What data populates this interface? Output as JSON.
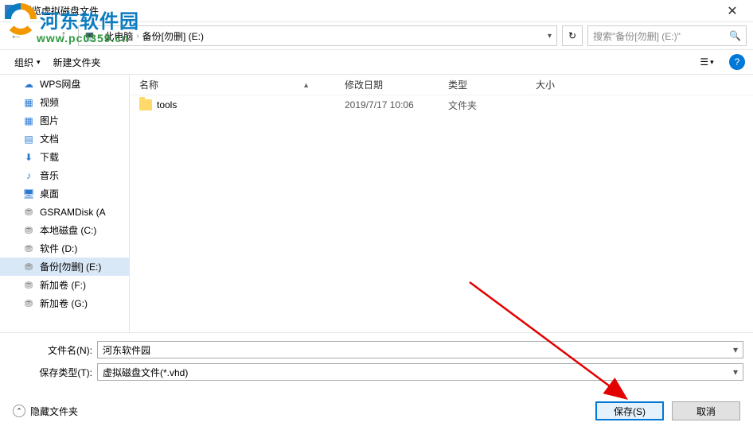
{
  "window": {
    "title": "浏览虚拟磁盘文件"
  },
  "nav": {
    "crumb1": "此电脑",
    "crumb2": "备份[勿删] (E:)",
    "search_placeholder": "搜索\"备份[勿删] (E:)\""
  },
  "toolbar": {
    "organize": "组织",
    "newfolder": "新建文件夹"
  },
  "sidebar": {
    "items": [
      {
        "label": "WPS网盘",
        "icon": "cloud",
        "color": "#2a7ad4"
      },
      {
        "label": "视频",
        "icon": "video",
        "color": "#2a7ad4"
      },
      {
        "label": "图片",
        "icon": "image",
        "color": "#2a7ad4"
      },
      {
        "label": "文档",
        "icon": "doc",
        "color": "#2a7ad4"
      },
      {
        "label": "下载",
        "icon": "download",
        "color": "#2a7ad4"
      },
      {
        "label": "音乐",
        "icon": "music",
        "color": "#2a7ad4"
      },
      {
        "label": "桌面",
        "icon": "desktop",
        "color": "#2a7ad4"
      },
      {
        "label": "GSRAMDisk (A",
        "icon": "drive",
        "color": "#888"
      },
      {
        "label": "本地磁盘 (C:)",
        "icon": "drive",
        "color": "#888"
      },
      {
        "label": "软件 (D:)",
        "icon": "drive",
        "color": "#888"
      },
      {
        "label": "备份[勿删] (E:)",
        "icon": "drive",
        "color": "#888",
        "selected": true
      },
      {
        "label": "新加卷 (F:)",
        "icon": "drive",
        "color": "#888"
      },
      {
        "label": "新加卷 (G:)",
        "icon": "drive",
        "color": "#888"
      }
    ]
  },
  "columns": {
    "name": "名称",
    "date": "修改日期",
    "type": "类型",
    "size": "大小"
  },
  "files": [
    {
      "name": "tools",
      "date": "2019/7/17 10:06",
      "type": "文件夹"
    }
  ],
  "form": {
    "filename_label": "文件名(N):",
    "filename_value": "河东软件园",
    "filetype_label": "保存类型(T):",
    "filetype_value": "虚拟磁盘文件(*.vhd)"
  },
  "footer": {
    "hide_label": "隐藏文件夹",
    "save": "保存(S)",
    "cancel": "取消"
  },
  "watermark": {
    "brand": "河东软件园",
    "url": "www.pc0359.cn"
  }
}
